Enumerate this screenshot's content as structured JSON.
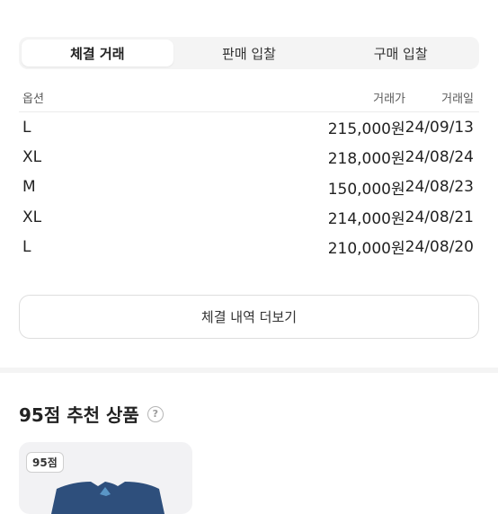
{
  "tabs": [
    {
      "label": "체결 거래",
      "active": true
    },
    {
      "label": "판매 입찰",
      "active": false
    },
    {
      "label": "구매 입찰",
      "active": false
    }
  ],
  "table": {
    "headers": {
      "option": "옵션",
      "price": "거래가",
      "date": "거래일"
    },
    "rows": [
      {
        "option": "L",
        "price": "215,000원",
        "date": "24/09/13"
      },
      {
        "option": "XL",
        "price": "218,000원",
        "date": "24/08/24"
      },
      {
        "option": "M",
        "price": "150,000원",
        "date": "24/08/23"
      },
      {
        "option": "XL",
        "price": "214,000원",
        "date": "24/08/21"
      },
      {
        "option": "L",
        "price": "210,000원",
        "date": "24/08/20"
      }
    ]
  },
  "more_button": "체결 내역 더보기",
  "recommend": {
    "title": "95점 추천 상품",
    "help_icon": "?",
    "card": {
      "badge": "95점"
    }
  },
  "colors": {
    "tab_bg": "#f4f4f4",
    "border": "#dedede",
    "product": "#2e4f7c"
  }
}
